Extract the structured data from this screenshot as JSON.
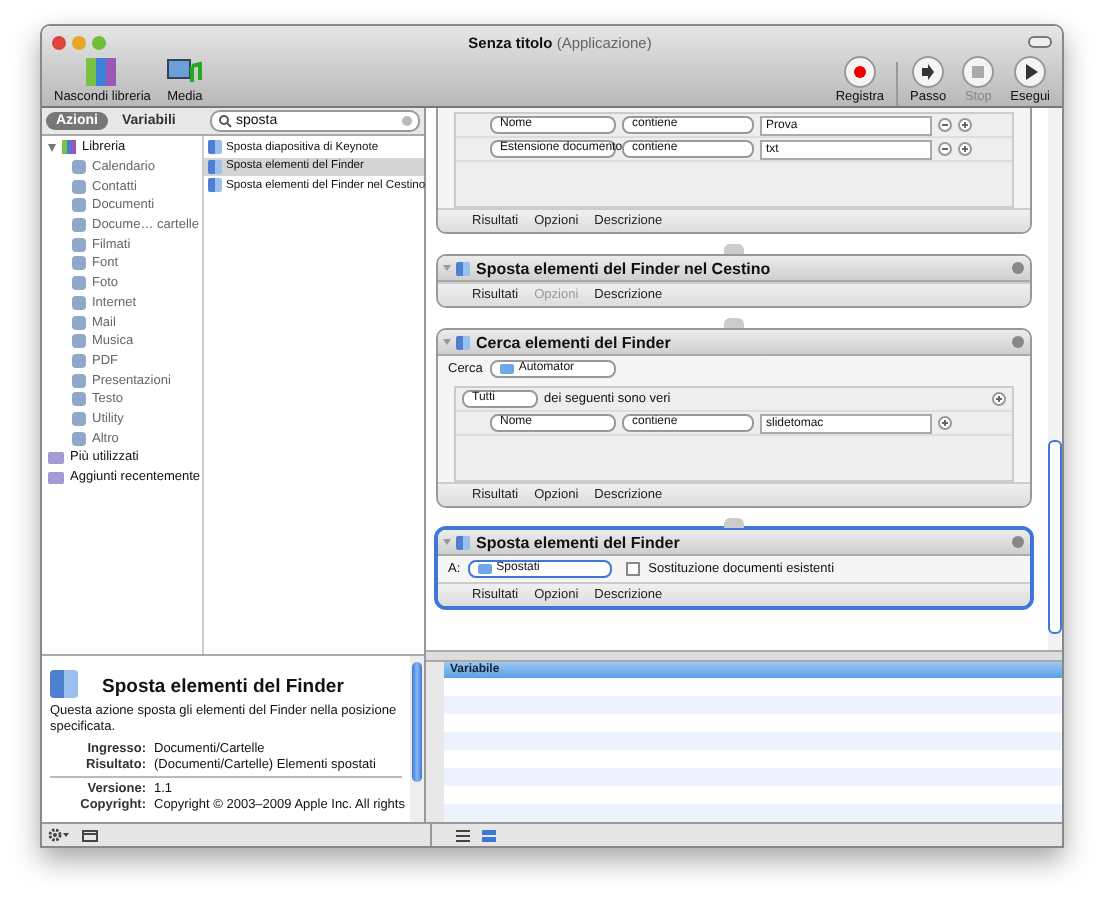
{
  "window": {
    "title": "Senza titolo",
    "subtitle": "(Applicazione)"
  },
  "toolbar": {
    "left": [
      {
        "label": "Nascondi libreria",
        "kind": "library"
      },
      {
        "label": "Media",
        "kind": "media"
      }
    ],
    "right": [
      {
        "label": "Registra",
        "kind": "record",
        "disabled": false
      },
      {
        "label": "Passo",
        "kind": "step",
        "disabled": false
      },
      {
        "label": "Stop",
        "kind": "stop",
        "disabled": true
      },
      {
        "label": "Esegui",
        "kind": "run",
        "disabled": false
      }
    ]
  },
  "library": {
    "tabs": [
      {
        "label": "Azioni",
        "selected": true
      },
      {
        "label": "Variabili",
        "selected": false
      }
    ],
    "search": {
      "value": "sposta"
    },
    "categories": [
      {
        "label": "Libreria",
        "expanded": true,
        "children": [
          {
            "label": "Calendario"
          },
          {
            "label": "Contatti"
          },
          {
            "label": "Documenti"
          },
          {
            "label": "Docume… cartelle"
          },
          {
            "label": "Filmati"
          },
          {
            "label": "Font"
          },
          {
            "label": "Foto"
          },
          {
            "label": "Internet"
          },
          {
            "label": "Mail"
          },
          {
            "label": "Musica"
          },
          {
            "label": "PDF"
          },
          {
            "label": "Presentazioni"
          },
          {
            "label": "Testo"
          },
          {
            "label": "Utility"
          },
          {
            "label": "Altro"
          }
        ]
      },
      {
        "label": "Più utilizzati"
      },
      {
        "label": "Aggiunti recentemente"
      }
    ],
    "results": [
      {
        "label": "Sposta diapositiva di Keynote",
        "selected": false
      },
      {
        "label": "Sposta elementi del Finder",
        "selected": true
      },
      {
        "label": "Sposta elementi del Finder nel Cestino",
        "selected": false
      }
    ]
  },
  "description": {
    "title": "Sposta elementi del Finder",
    "text": "Questa azione sposta gli elementi del Finder nella posizione specificata.",
    "details": [
      {
        "key": "Ingresso:",
        "value": "Documenti/Cartelle"
      },
      {
        "key": "Risultato:",
        "value": "(Documenti/Cartelle) Elementi spostati"
      }
    ],
    "meta": [
      {
        "key": "Versione:",
        "value": "1.1"
      },
      {
        "key": "Copyright:",
        "value": "Copyright © 2003–2009 Apple Inc.  All rights"
      }
    ]
  },
  "workflow": {
    "actions": [
      {
        "kind": "criteria",
        "selected": false,
        "conditions": [
          {
            "field": "Nome",
            "operator": "contiene",
            "value": "Prova",
            "removable": true
          },
          {
            "field": "Estensione documento",
            "operator": "contiene",
            "value": "txt",
            "removable": true
          }
        ],
        "footer": [
          {
            "label": "Risultati",
            "disabled": false
          },
          {
            "label": "Opzioni",
            "disabled": false
          },
          {
            "label": "Descrizione",
            "disabled": false
          }
        ]
      },
      {
        "kind": "plain",
        "title": "Sposta elementi del Finder nel Cestino",
        "selected": false,
        "footer": [
          {
            "label": "Risultati",
            "disabled": false
          },
          {
            "label": "Opzioni",
            "disabled": true
          },
          {
            "label": "Descrizione",
            "disabled": false
          }
        ]
      },
      {
        "kind": "search",
        "title": "Cerca elementi del Finder",
        "selected": false,
        "location_label": "Cerca",
        "location": "Automator",
        "match": "Tutti",
        "match_text": "dei seguenti sono veri",
        "conditions": [
          {
            "field": "Nome",
            "operator": "contiene",
            "value": "slidetomac",
            "removable": false
          }
        ],
        "footer": [
          {
            "label": "Risultati",
            "disabled": false
          },
          {
            "label": "Opzioni",
            "disabled": false
          },
          {
            "label": "Descrizione",
            "disabled": false
          }
        ]
      },
      {
        "kind": "move",
        "title": "Sposta elementi del Finder",
        "selected": true,
        "destination_label": "A:",
        "destination": "Spostati",
        "checkbox": {
          "label": "Sostituzione documenti esistenti",
          "checked": false
        },
        "footer": [
          {
            "label": "Risultati",
            "disabled": false
          },
          {
            "label": "Opzioni",
            "disabled": false
          },
          {
            "label": "Descrizione",
            "disabled": false
          }
        ]
      }
    ]
  },
  "variables": {
    "column": "Variabile"
  }
}
